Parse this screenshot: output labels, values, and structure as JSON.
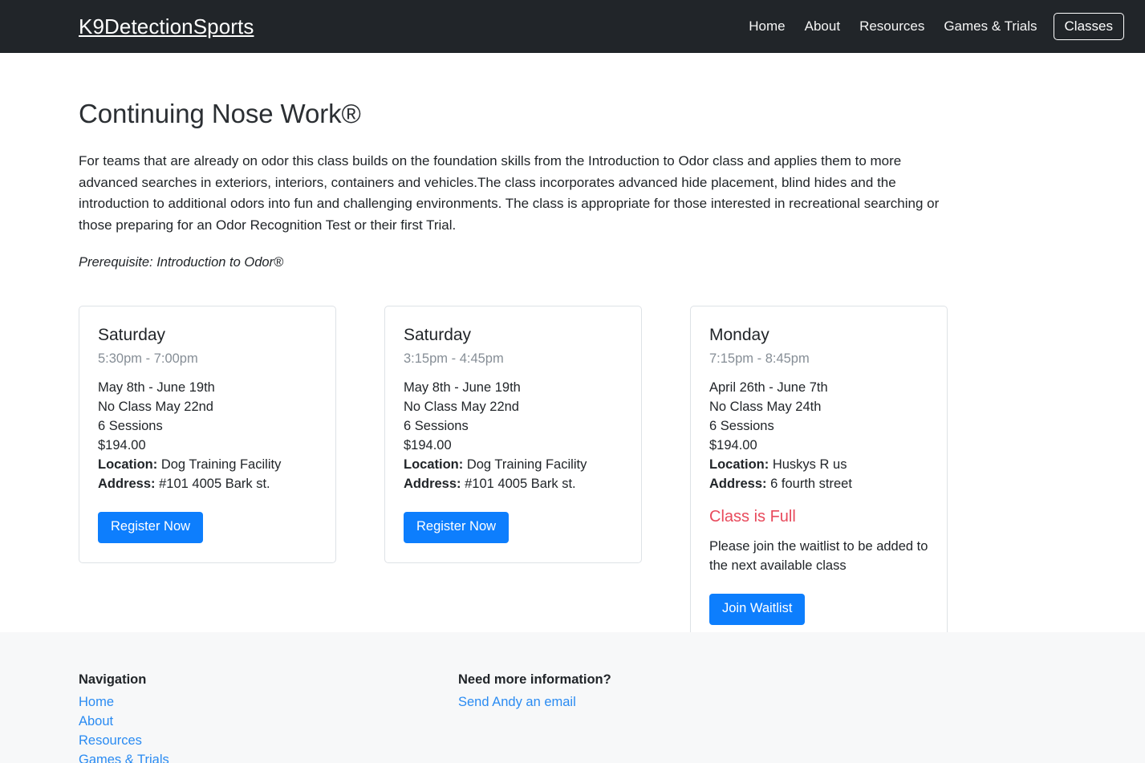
{
  "navbar": {
    "brand": "K9DetectionSports",
    "links": [
      {
        "label": "Home",
        "boxed": false
      },
      {
        "label": "About",
        "boxed": false
      },
      {
        "label": "Resources",
        "boxed": false
      },
      {
        "label": "Games & Trials",
        "boxed": false
      },
      {
        "label": "Classes",
        "boxed": true
      }
    ],
    "bg_color": "#212529",
    "text_color": "#ffffff"
  },
  "main": {
    "title": "Continuing Nose Work®",
    "intro": "For teams that are already on odor this class builds on the foundation skills from the Introduction to Odor class and applies them to more advanced searches in exteriors, interiors, containers and vehicles.The class incorporates advanced hide placement, blind hides and the introduction to additional odors into fun and challenging environments. The class is appropriate for those interested in recreational searching or those preparing for an Odor Recognition Test or their first Trial.",
    "prerequisite": "Prerequisite: Introduction to Odor®"
  },
  "classes": [
    {
      "day": "Saturday",
      "time": "5:30pm - 7:00pm",
      "dates": "May 8th - June 19th",
      "no_class": "No Class May 22nd",
      "sessions": "6 Sessions",
      "price": "$194.00",
      "location_label": "Location:",
      "location": "Dog Training Facility",
      "address_label": "Address:",
      "address": "#101 4005 Bark st.",
      "is_full": false,
      "button_label": "Register Now"
    },
    {
      "day": "Saturday",
      "time": "3:15pm - 4:45pm",
      "dates": "May 8th - June 19th",
      "no_class": "No Class May 22nd",
      "sessions": "6 Sessions",
      "price": "$194.00",
      "location_label": "Location:",
      "location": "Dog Training Facility",
      "address_label": "Address:",
      "address": "#101 4005 Bark st.",
      "is_full": false,
      "button_label": "Register Now"
    },
    {
      "day": "Monday",
      "time": "7:15pm - 8:45pm",
      "dates": "April 26th - June 7th",
      "no_class": "No Class May 24th",
      "sessions": "6 Sessions",
      "price": "$194.00",
      "location_label": "Location:",
      "location": "Huskys R us",
      "address_label": "Address:",
      "address": "6 fourth street",
      "is_full": true,
      "full_notice": "Class is Full",
      "waitlist_message": "Please join the waitlist to be added to the next available class",
      "button_label": "Join Waitlist"
    }
  ],
  "footer": {
    "nav_heading": "Navigation",
    "nav_links": [
      "Home",
      "About",
      "Resources",
      "Games & Trials"
    ],
    "info_heading": "Need more information?",
    "info_link": "Send Andy an email",
    "bg_color": "#f7f8f9",
    "link_color": "#2a8bf2"
  },
  "colors": {
    "primary_button": "#0d7efd",
    "danger_text": "#e84a5c",
    "card_border": "#dee2e6",
    "muted_text": "#868e96"
  }
}
